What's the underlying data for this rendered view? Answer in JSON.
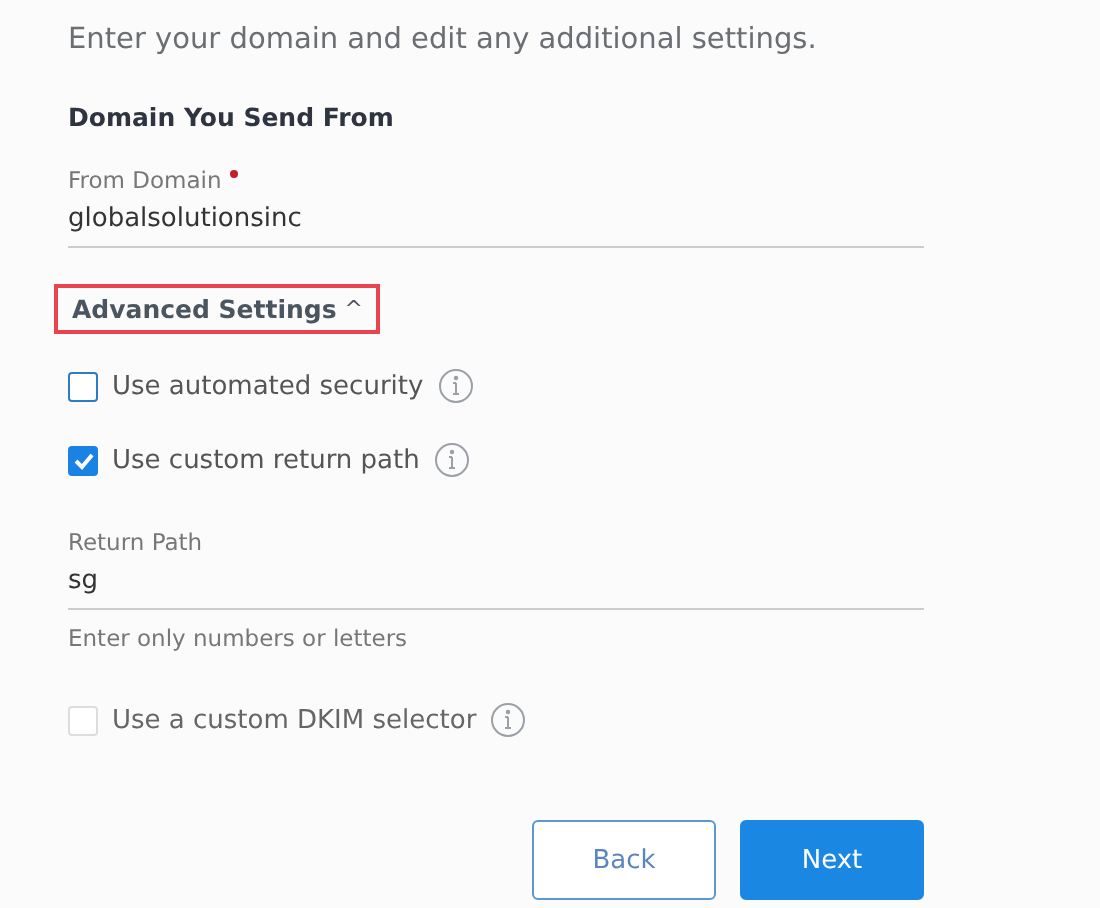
{
  "intro": "Enter your domain and edit any additional settings.",
  "section_title": "Domain You Send From",
  "from_domain": {
    "label": "From Domain",
    "required": true,
    "value": "globalsolutionsinc"
  },
  "advanced": {
    "label": "Advanced Settings",
    "caret": "^",
    "expanded": true,
    "highlighted": true
  },
  "options": [
    {
      "kind": "checkbox",
      "label": "Use automated security",
      "checked": false,
      "disabled": false
    },
    {
      "kind": "checkbox",
      "label": "Use custom return path",
      "checked": true,
      "disabled": false
    },
    {
      "kind": "field",
      "label": "Return Path",
      "value": "sg",
      "hint": "Enter only numbers or letters"
    },
    {
      "kind": "checkbox",
      "label": "Use a custom DKIM selector",
      "checked": false,
      "disabled": true
    }
  ],
  "buttons": [
    {
      "label": "Back",
      "kind": "secondary"
    },
    {
      "label": "Next",
      "kind": "primary"
    }
  ]
}
